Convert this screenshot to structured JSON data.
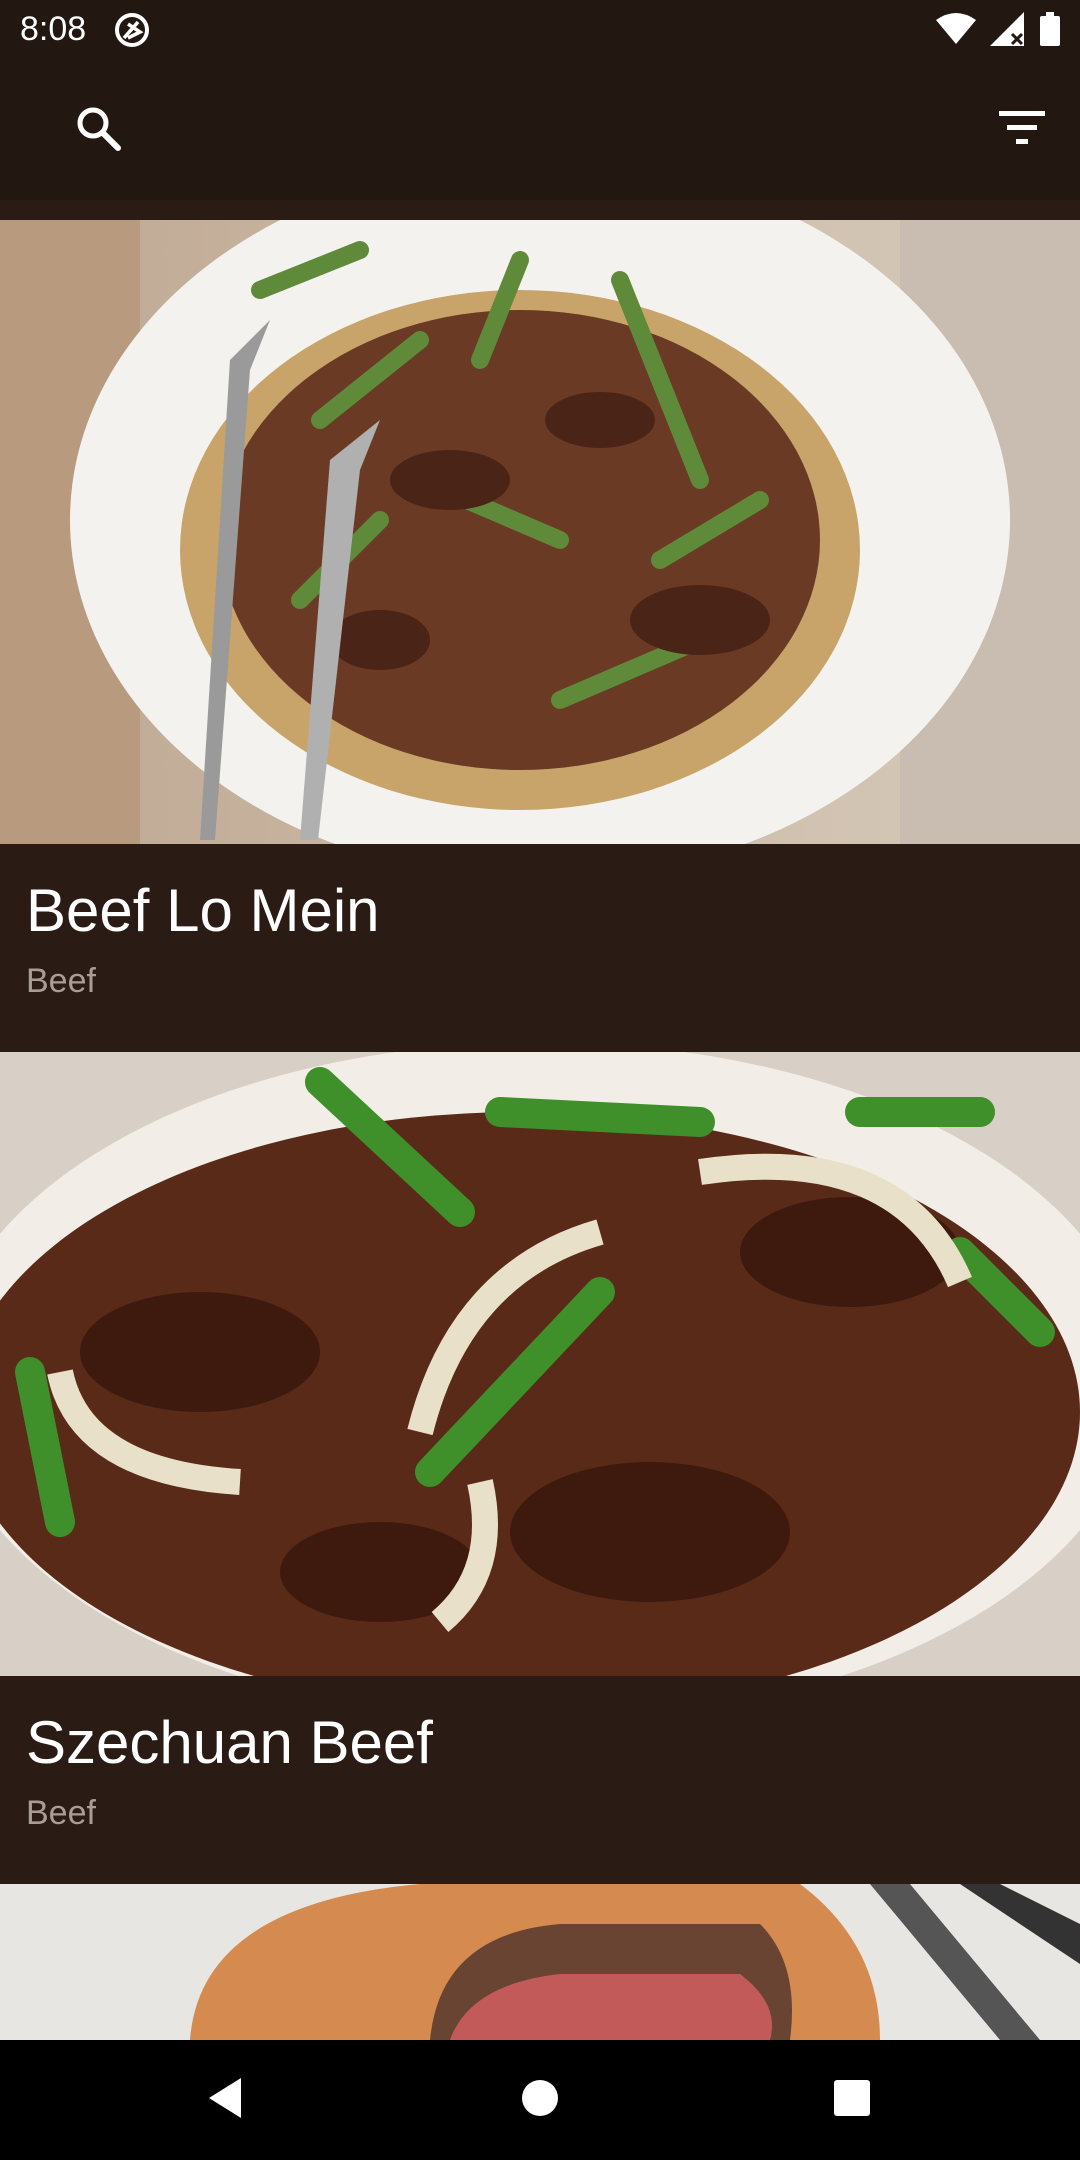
{
  "status_bar": {
    "time": "8:08",
    "icons": [
      "app-notification-icon",
      "wifi-icon",
      "signal-icon",
      "battery-icon"
    ]
  },
  "app_bar": {
    "search_icon": "search-icon",
    "filter_icon": "filter-icon"
  },
  "recipes": [
    {
      "title": "Beef Lo Mein",
      "category": "Beef",
      "image": "beef-lo-mein-photo"
    },
    {
      "title": "Szechuan Beef",
      "category": "Beef",
      "image": "szechuan-beef-photo"
    },
    {
      "title": "",
      "category": "",
      "image": "beef-wellington-photo"
    }
  ],
  "nav_bar": {
    "icons": [
      "back-icon",
      "home-icon",
      "recents-icon"
    ]
  },
  "colors": {
    "background": "#2a1c14",
    "bar": "#231811",
    "subtitle": "#a99e97"
  }
}
